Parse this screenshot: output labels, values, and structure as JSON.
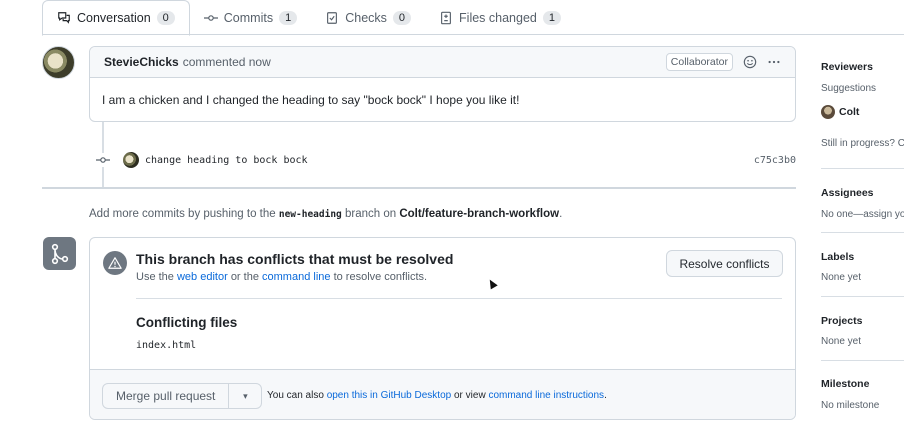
{
  "tabs": [
    {
      "label": "Conversation",
      "count": "0",
      "icon": "conversation-icon"
    },
    {
      "label": "Commits",
      "count": "1",
      "icon": "commit-icon"
    },
    {
      "label": "Checks",
      "count": "0",
      "icon": "checks-icon"
    },
    {
      "label": "Files changed",
      "count": "1",
      "icon": "file-diff-icon"
    }
  ],
  "comment": {
    "author": "StevieChicks",
    "action": "commented now",
    "role_badge": "Collaborator",
    "body": "I am a chicken and I changed the heading to say \"bock bock\" I hope you like it!"
  },
  "commit": {
    "message": "change heading to bock bock",
    "sha": "c75c3b0"
  },
  "add_more": {
    "prefix": "Add more commits by pushing to the",
    "branch": "new-heading",
    "middle": "branch on",
    "repo": "Colt/feature-branch-workflow",
    "suffix": "."
  },
  "merge": {
    "title": "This branch has conflicts that must be resolved",
    "sub_prefix": "Use the",
    "web_editor": "web editor",
    "sub_or": "or the",
    "command_line": "command line",
    "sub_suffix": "to resolve conflicts.",
    "resolve_button": "Resolve conflicts",
    "conflicting_title": "Conflicting files",
    "conflicting_file": "index.html",
    "merge_button": "Merge pull request",
    "also_prefix": "You can also",
    "open_desktop": "open this in GitHub Desktop",
    "also_or": "or view",
    "cli_instructions": "command line instructions",
    "also_suffix": "."
  },
  "sidebar": {
    "reviewers_heading": "Reviewers",
    "suggestions": "Suggestions",
    "suggested_user": "Colt",
    "in_progress": "Still in progress? C",
    "assignees_heading": "Assignees",
    "assignees_value": "No one—assign yo",
    "labels_heading": "Labels",
    "labels_value": "None yet",
    "projects_heading": "Projects",
    "projects_value": "None yet",
    "milestone_heading": "Milestone",
    "milestone_value": "No milestone"
  },
  "colors": {
    "link": "#0969da",
    "border": "#d0d7de",
    "muted": "#57606a",
    "icon_bg": "#6e7781"
  }
}
